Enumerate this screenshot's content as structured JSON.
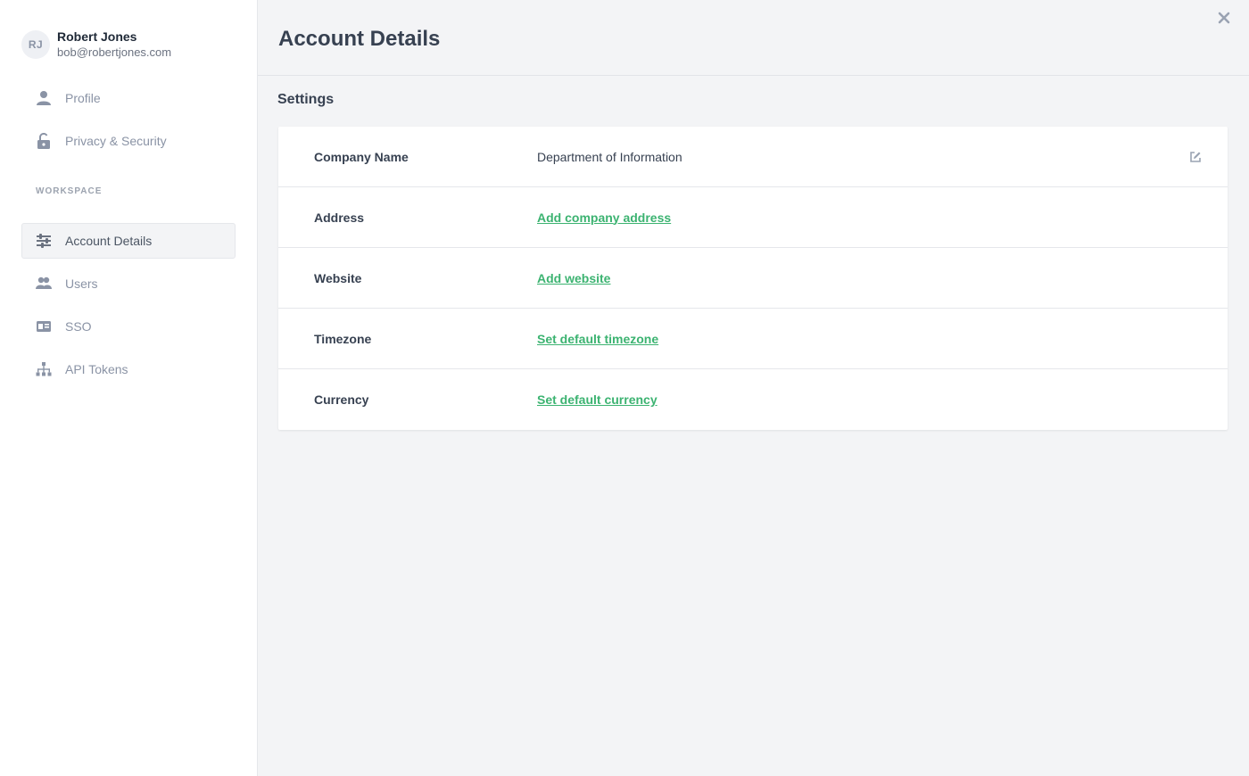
{
  "user": {
    "initials": "RJ",
    "name": "Robert Jones",
    "email": "bob@robertjones.com"
  },
  "sidebar": {
    "personal_items": [
      {
        "label": "Profile",
        "icon": "user-icon"
      },
      {
        "label": "Privacy & Security",
        "icon": "lock-icon"
      }
    ],
    "workspace_label": "WORKSPACE",
    "workspace_items": [
      {
        "label": "Account Details",
        "icon": "sliders-icon",
        "active": true
      },
      {
        "label": "Users",
        "icon": "users-icon"
      },
      {
        "label": "SSO",
        "icon": "id-card-icon"
      },
      {
        "label": "API Tokens",
        "icon": "sitemap-icon"
      }
    ]
  },
  "header": {
    "title": "Account Details",
    "close_icon": "close-icon"
  },
  "settings": {
    "title": "Settings",
    "rows": [
      {
        "label": "Company Name",
        "value": "Department of Information",
        "type": "text",
        "edit_icon": "edit-icon"
      },
      {
        "label": "Address",
        "value": "Add company address",
        "type": "link"
      },
      {
        "label": "Website",
        "value": "Add website",
        "type": "link"
      },
      {
        "label": "Timezone",
        "value": "Set default timezone",
        "type": "link"
      },
      {
        "label": "Currency",
        "value": "Set default currency",
        "type": "link"
      }
    ]
  },
  "colors": {
    "accent_link": "#3cb371",
    "sidebar_text": "#8a93a5",
    "background": "#f3f4f6"
  }
}
